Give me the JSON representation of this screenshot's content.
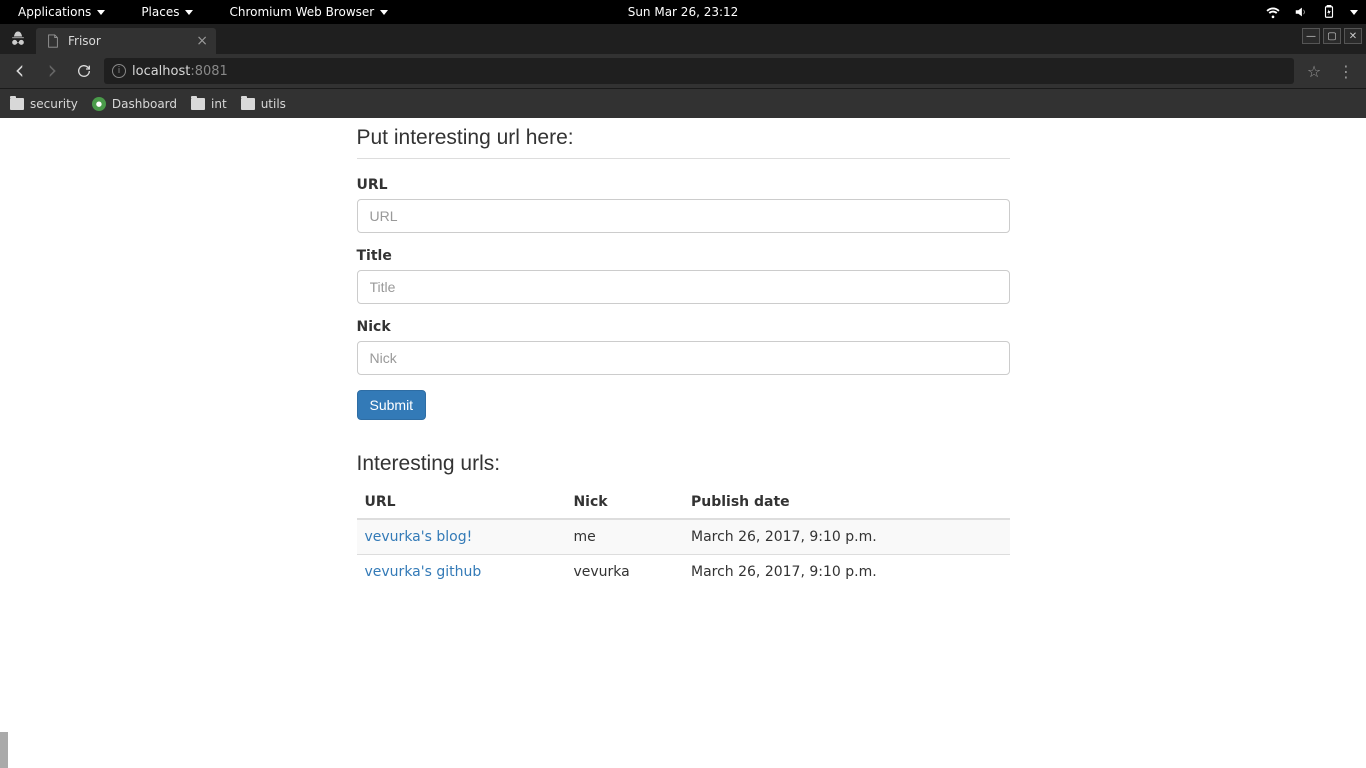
{
  "gnome": {
    "applications": "Applications",
    "places": "Places",
    "app_name": "Chromium Web Browser",
    "clock": "Sun Mar 26, 23:12"
  },
  "browser": {
    "tab_title": "Frisor",
    "url_host": "localhost",
    "url_port": ":8081",
    "bookmarks": {
      "security": "security",
      "dashboard": "Dashboard",
      "int": "int",
      "utils": "utils"
    }
  },
  "page": {
    "form_heading": "Put interesting url here:",
    "url_label": "URL",
    "url_placeholder": "URL",
    "title_label": "Title",
    "title_placeholder": "Title",
    "nick_label": "Nick",
    "nick_placeholder": "Nick",
    "submit": "Submit",
    "list_heading": "Interesting urls:",
    "columns": {
      "url": "URL",
      "nick": "Nick",
      "date": "Publish date"
    },
    "rows": [
      {
        "title": "vevurka's blog!",
        "nick": "me",
        "date": "March 26, 2017, 9:10 p.m."
      },
      {
        "title": "vevurka's github",
        "nick": "vevurka",
        "date": "March 26, 2017, 9:10 p.m."
      }
    ]
  }
}
